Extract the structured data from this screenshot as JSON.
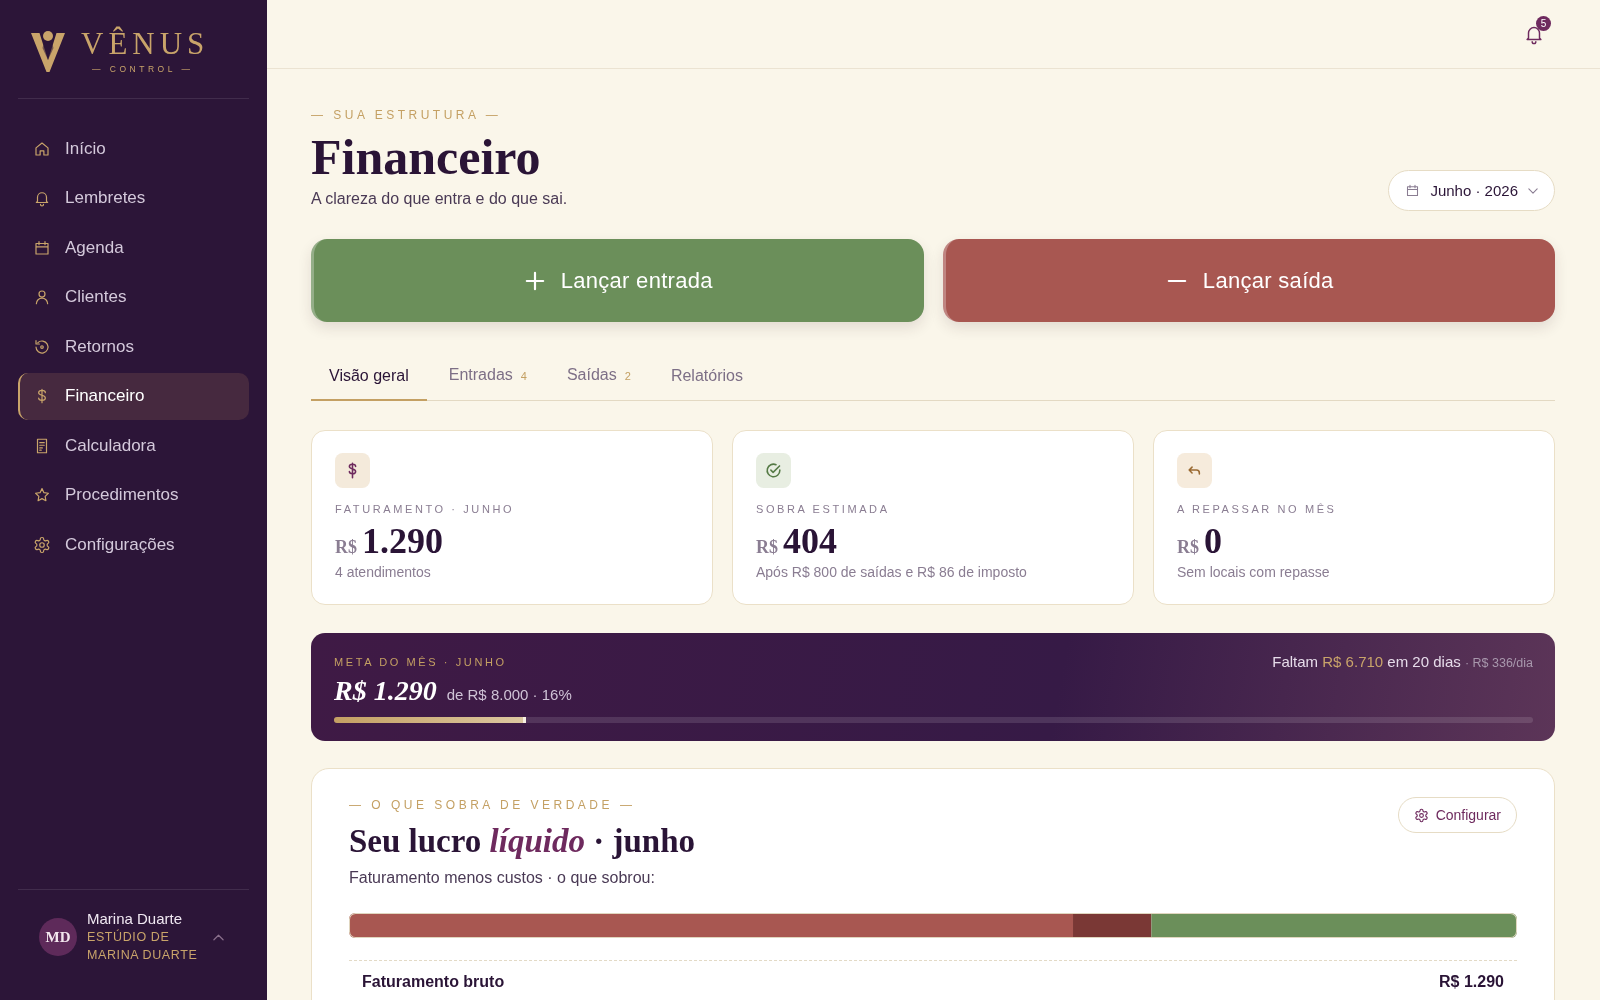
{
  "sidebar": {
    "brand": {
      "name": "VÊNUS",
      "tagline": "— CONTROL —"
    },
    "nav": [
      {
        "label": "Início",
        "selected": false
      },
      {
        "label": "Lembretes",
        "selected": false
      },
      {
        "label": "Agenda",
        "selected": false
      },
      {
        "label": "Clientes",
        "selected": false
      },
      {
        "label": "Retornos",
        "selected": false
      },
      {
        "label": "Financeiro",
        "selected": true
      },
      {
        "label": "Calculadora",
        "selected": false
      },
      {
        "label": "Procedimentos",
        "selected": false
      },
      {
        "label": "Configurações",
        "selected": false
      }
    ],
    "user": {
      "initials": "MD",
      "name": "Marina Duarte",
      "studio": "ESTÚDIO DE MARINA DUARTE"
    }
  },
  "topbar": {
    "notification_count": "5"
  },
  "header": {
    "eyebrow": "— SUA ESTRUTURA —",
    "title": "Financeiro",
    "subtitle": "A clareza do que entra e do que sai.",
    "period": "Junho · 2026"
  },
  "actions": [
    {
      "kind": "income",
      "label": "Lançar entrada"
    },
    {
      "kind": "expense",
      "label": "Lançar saída"
    }
  ],
  "tabs": [
    {
      "label": "Visão geral",
      "selected": true
    },
    {
      "label": "Entradas",
      "count": "4",
      "selected": false
    },
    {
      "label": "Saídas",
      "count": "2",
      "selected": false
    },
    {
      "label": "Relatórios",
      "selected": false
    }
  ],
  "cards": [
    {
      "kind": "revenue",
      "label": "FATURAMENTO · JUNHO",
      "currency": "R$",
      "value": "1.290",
      "note": "4 atendimentos"
    },
    {
      "kind": "surplus",
      "label": "SOBRA ESTIMADA",
      "currency": "R$",
      "value": "404",
      "note": "Após R$ 800 de saídas e R$ 86 de imposto"
    },
    {
      "kind": "transfer",
      "label": "A REPASSAR NO MÊS",
      "currency": "R$",
      "value": "0",
      "note": "Sem locais com repasse"
    }
  ],
  "goal": {
    "label": "META DO MÊS · JUNHO",
    "value": "R$ 1.290",
    "target": "de R$ 8.000 · 16%",
    "remaining": {
      "prefix": "Faltam",
      "amount": "R$ 6.710",
      "suffix": "em 20 dias",
      "daily": "· R$ 336/dia"
    },
    "level": 0.16
  },
  "profit": {
    "eyebrow": "— O QUE SOBRA DE VERDADE —",
    "title": "Seu lucro *líquido* · junho",
    "configure": "Configurar",
    "subtitle": "Faturamento menos custos · o que sobrou:",
    "rows": [
      {
        "label": "Faturamento bruto",
        "value": "R$ 1.290"
      }
    ]
  }
}
